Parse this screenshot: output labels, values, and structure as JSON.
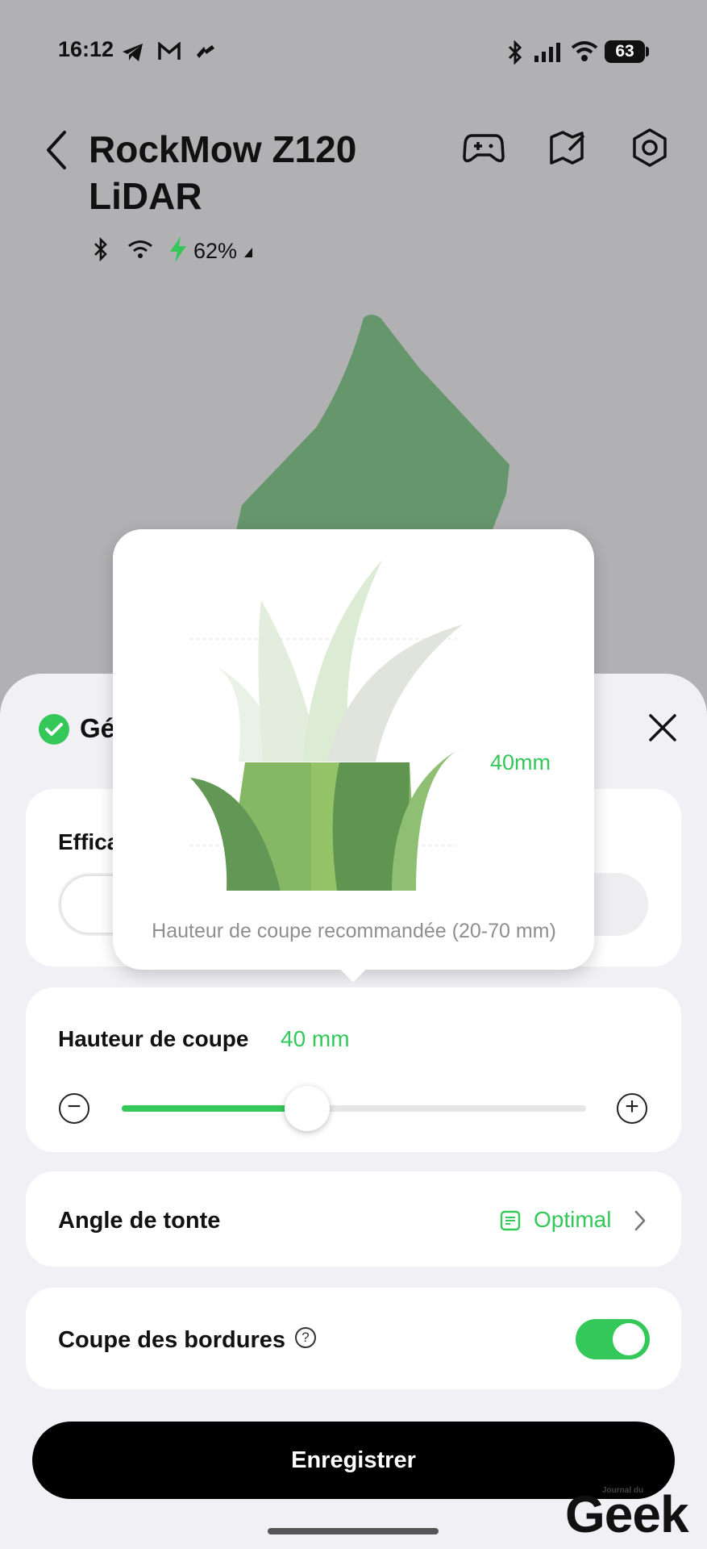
{
  "status_bar": {
    "time": "16:12",
    "battery_level": "63",
    "icons": [
      "telegram-icon",
      "gmail-icon",
      "app-icon",
      "bluetooth-icon",
      "signal-icon",
      "wifi-icon"
    ]
  },
  "header": {
    "title": "RockMow Z120 LiDAR",
    "back_icon": "chevron-left-icon",
    "actions": [
      "gamepad-icon",
      "map-edit-icon",
      "settings-icon"
    ],
    "connection": {
      "icons": [
        "bluetooth-icon",
        "wifi-icon",
        "charging-bolt-icon"
      ],
      "battery_percent": "62%"
    }
  },
  "map": {
    "zone_color": "#66966b"
  },
  "sheet": {
    "title_visible": "Gé",
    "close_icon": "close-icon",
    "efficiency_label_visible": "Effica"
  },
  "popup": {
    "height_label": "40mm",
    "caption": "Hauteur de coupe recommandée (20-70 mm)",
    "illustration": "grass-illustration"
  },
  "cutting_height": {
    "label": "Hauteur de coupe",
    "value": "40 mm",
    "slider_fraction": 0.4,
    "minus_icon": "minus-circle-icon",
    "plus_icon": "plus-circle-icon"
  },
  "mowing_angle": {
    "label": "Angle de tonte",
    "value": "Optimal",
    "icon": "pattern-icon"
  },
  "border_cutting": {
    "label": "Coupe des bordures",
    "help": "?",
    "enabled": true
  },
  "save_button": "Enregistrer",
  "watermark": {
    "big": "Geek",
    "small": "Journal du"
  },
  "colors": {
    "accent": "#34c759",
    "overlay_bg": "#b1b1b3",
    "sheet_bg": "#f1f1f5",
    "button_bg": "#000000"
  }
}
